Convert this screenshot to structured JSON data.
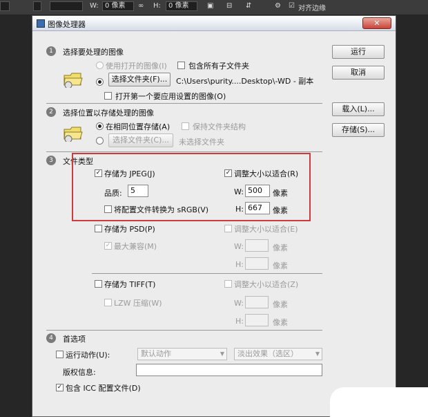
{
  "toolbar": {
    "w_label": "W:",
    "w_value": "0 像素",
    "h_label": "H:",
    "h_value": "0 像素",
    "align_edges": "对齐边缘"
  },
  "dialog": {
    "title": "图像处理器",
    "close": "✕",
    "buttons": {
      "run": "运行",
      "cancel": "取消",
      "load": "载入(L)...",
      "save": "存储(S)..."
    },
    "section1": {
      "number": "1",
      "title": "选择要处理的图像",
      "use_open": "使用打开的图像(I)",
      "include_sub": "包含所有子文件夹",
      "select_folder": "选择文件夹(F)...",
      "path": "C:\\Users\\purity....Desktop\\-WD - 副本",
      "open_first": "打开第一个要应用设置的图像(O)"
    },
    "section2": {
      "number": "2",
      "title": "选择位置以存储处理的图像",
      "same_location": "在相同位置存储(A)",
      "keep_structure": "保持文件夹结构",
      "select_folder": "选择文件夹(C)...",
      "no_folder": "未选择文件夹"
    },
    "section3": {
      "number": "3",
      "title": "文件类型",
      "jpeg": {
        "save_as": "存储为 JPEG(J)",
        "resize": "调整大小以适合(R)",
        "quality_label": "品质:",
        "quality": "5",
        "w_label": "W:",
        "w": "500",
        "h_label": "H:",
        "h": "667",
        "unit": "像素",
        "srgb": "将配置文件转换为 sRGB(V)"
      },
      "psd": {
        "save_as": "存储为 PSD(P)",
        "resize": "调整大小以适合(E)",
        "max_compat": "最大兼容(M)",
        "w_label": "W:",
        "h_label": "H:",
        "unit": "像素"
      },
      "tiff": {
        "save_as": "存储为 TIFF(T)",
        "resize": "调整大小以适合(Z)",
        "lzw": "LZW 压缩(W)",
        "w_label": "W:",
        "h_label": "H:",
        "unit": "像素"
      }
    },
    "section4": {
      "number": "4",
      "title": "首选项",
      "run_action": "运行动作(U):",
      "action_set": "默认动作",
      "action": "淡出效果（选区）",
      "copyright": "版权信息:",
      "icc": "包含 ICC 配置文件(D)"
    }
  }
}
